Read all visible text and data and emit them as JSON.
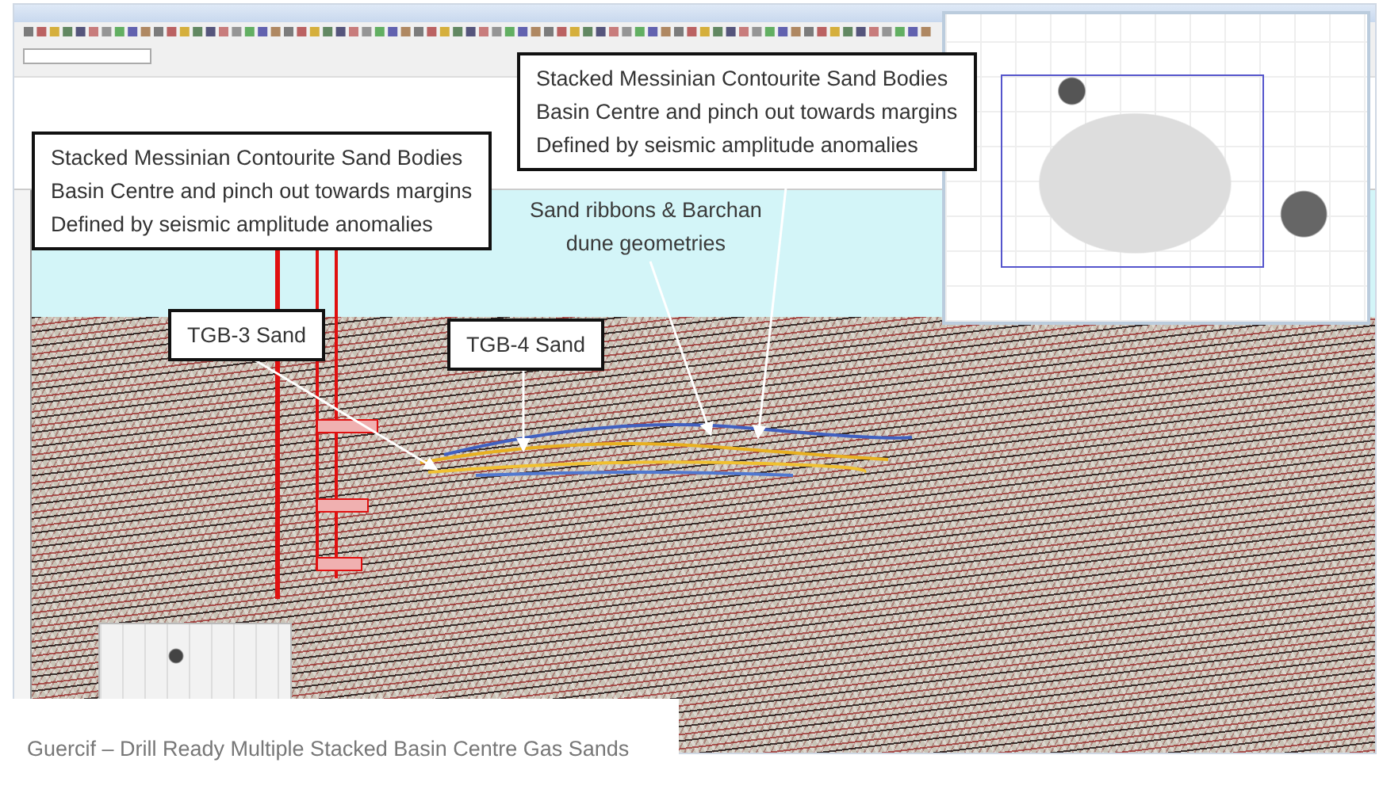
{
  "callouts": [
    {
      "kind": "box",
      "lines": [
        "Stacked Messinian Contourite Sand Bodies",
        "Basin Centre and pinch out towards margins",
        "Defined by seismic amplitude anomalies"
      ]
    },
    {
      "kind": "box",
      "lines": [
        "Stacked Messinian Contourite Sand Bodies",
        "Basin Centre and pinch out towards margins",
        "Defined by seismic amplitude anomalies"
      ]
    },
    {
      "kind": "plain",
      "lines": [
        "Sand ribbons & Barchan",
        "dune geometries"
      ]
    },
    {
      "kind": "box",
      "lines": [
        "TGB-3 Sand"
      ]
    },
    {
      "kind": "box",
      "lines": [
        "TGB-4 Sand"
      ]
    }
  ],
  "caption": "Guercif – Drill Ready Multiple Stacked Basin Centre Gas Sands"
}
